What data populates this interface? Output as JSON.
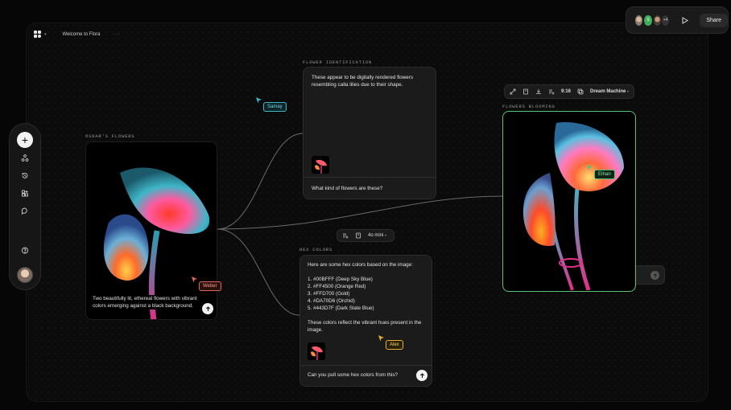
{
  "header": {
    "title": "Welcome to Flora",
    "more": "···"
  },
  "collab": {
    "extra_count": "+4",
    "share_label": "Share",
    "avatar_initial": "S"
  },
  "nodes": {
    "oskar": {
      "label": "OSKAR'S FLOWERS",
      "caption": "Two beautifully lit, ethereal flowers with vibrant colors emerging against a black background."
    },
    "identification": {
      "label": "FLOWER IDENTIFICATION",
      "response": "These appear to be digitally rendered flowers resembling calla lilies due to their shape.",
      "prompt": "What kind of flowers are these?"
    },
    "hex": {
      "label": "HEX COLORS",
      "intro": "Here are some hex colors based on the image:",
      "colors": [
        "1. #00BFFF (Deep Sky Blue)",
        "2. #FF4500 (Orange Red)",
        "3. #FFD700 (Gold)",
        "4. #DA70D6 (Orchid)",
        "5. #443D7F (Dark Slate Blue)"
      ],
      "outro": "These colors reflect the vibrant hues present in the image.",
      "prompt": "Can you pull some hex colors from this?",
      "model": "4o mini"
    },
    "blooming": {
      "label": "FLOWERS BLOOMING",
      "ratio": "9:16",
      "model": "Dream Machine"
    }
  },
  "cursors": [
    {
      "name": "Samay",
      "color": "#3fb6c8"
    },
    {
      "name": "Ethan",
      "color": "#55c27a"
    },
    {
      "name": "Weber",
      "color": "#e0675a"
    },
    {
      "name": "Alex",
      "color": "#e0b23a"
    }
  ],
  "icons": [
    "flora-logo-icon",
    "plus-icon",
    "nodes-icon",
    "history-icon",
    "apps-icon",
    "chat-icon",
    "help-icon",
    "play-icon",
    "expand-icon",
    "bookmark-icon",
    "download-icon",
    "add-list-icon",
    "copy-icon",
    "send-icon"
  ]
}
